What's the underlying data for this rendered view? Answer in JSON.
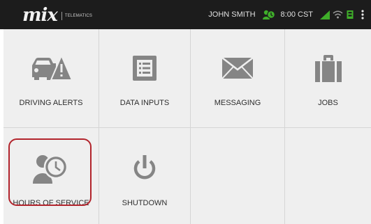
{
  "header": {
    "logo_text": "mix",
    "logo_subtitle": "TELEMATICS",
    "user_name": "JOHN SMITH",
    "time": "8:00 CST",
    "icons": [
      "hos-status-icon",
      "signal-icon",
      "wifi-icon",
      "device-icon",
      "overflow-menu-icon"
    ]
  },
  "tiles": [
    {
      "label": "DRIVING ALERTS",
      "icon": "car-alert-icon"
    },
    {
      "label": "DATA INPUTS",
      "icon": "data-form-icon"
    },
    {
      "label": "MESSAGING",
      "icon": "envelope-icon"
    },
    {
      "label": "JOBS",
      "icon": "briefcase-icon"
    },
    {
      "label": "HOURS OF SERVICE",
      "icon": "hours-of-service-icon",
      "highlighted": true
    },
    {
      "label": "SHUTDOWN",
      "icon": "power-icon"
    },
    {
      "label": "",
      "icon": ""
    },
    {
      "label": "",
      "icon": ""
    }
  ],
  "colors": {
    "topbar": "#1c1c1c",
    "tile": "#efefef",
    "grid": "#d5d5d5",
    "icon": "#858585",
    "status_green": "#3fae2a",
    "highlight": "#b2242c"
  }
}
